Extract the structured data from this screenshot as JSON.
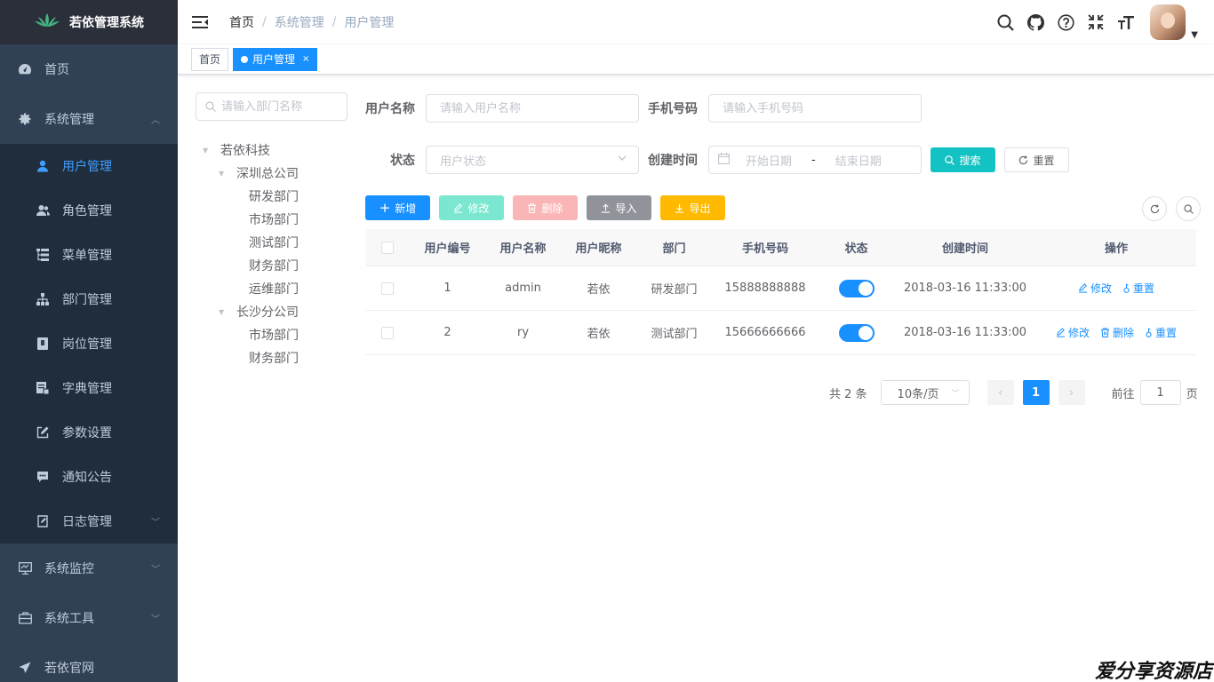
{
  "sidebar": {
    "title": "若依管理系统",
    "items": [
      {
        "label": "首页"
      },
      {
        "label": "系统管理"
      },
      {
        "label": "用户管理"
      },
      {
        "label": "角色管理"
      },
      {
        "label": "菜单管理"
      },
      {
        "label": "部门管理"
      },
      {
        "label": "岗位管理"
      },
      {
        "label": "字典管理"
      },
      {
        "label": "参数设置"
      },
      {
        "label": "通知公告"
      },
      {
        "label": "日志管理"
      },
      {
        "label": "系统监控"
      },
      {
        "label": "系统工具"
      },
      {
        "label": "若依官网"
      }
    ]
  },
  "breadcrumb": [
    "首页",
    "系统管理",
    "用户管理"
  ],
  "tags": [
    {
      "label": "首页"
    },
    {
      "label": "用户管理"
    }
  ],
  "dept_tree": {
    "placeholder": "请输入部门名称",
    "nodes": [
      "若依科技",
      "深圳总公司",
      "研发部门",
      "市场部门",
      "测试部门",
      "财务部门",
      "运维部门",
      "长沙分公司",
      "市场部门",
      "财务部门"
    ]
  },
  "query": {
    "username_label": "用户名称",
    "username_placeholder": "请输入用户名称",
    "phone_label": "手机号码",
    "phone_placeholder": "请输入手机号码",
    "status_label": "状态",
    "status_placeholder": "用户状态",
    "created_label": "创建时间",
    "start_placeholder": "开始日期",
    "range_sep": "-",
    "end_placeholder": "结束日期",
    "search_label": "搜索",
    "reset_label": "重置"
  },
  "toolbar": {
    "add": "新增",
    "edit": "修改",
    "delete": "删除",
    "import": "导入",
    "export": "导出"
  },
  "table": {
    "columns": [
      "用户编号",
      "用户名称",
      "用户昵称",
      "部门",
      "手机号码",
      "状态",
      "创建时间",
      "操作"
    ],
    "rows": [
      {
        "id": "1",
        "username": "admin",
        "nickname": "若依",
        "dept": "研发部门",
        "phone": "15888888888",
        "created": "2018-03-16 11:33:00",
        "ops": [
          "修改",
          "重置"
        ]
      },
      {
        "id": "2",
        "username": "ry",
        "nickname": "若依",
        "dept": "测试部门",
        "phone": "15666666666",
        "created": "2018-03-16 11:33:00",
        "ops": [
          "修改",
          "删除",
          "重置"
        ]
      }
    ]
  },
  "pagination": {
    "total": "共 2 条",
    "page_size": "10条/页",
    "current": "1",
    "goto_label": "前往",
    "goto_value": "1",
    "goto_suffix": "页"
  },
  "watermark": "爱分享资源店",
  "colors": {
    "primary": "#1890ff",
    "sidebar": "#304156",
    "search": "#13c2c2"
  }
}
